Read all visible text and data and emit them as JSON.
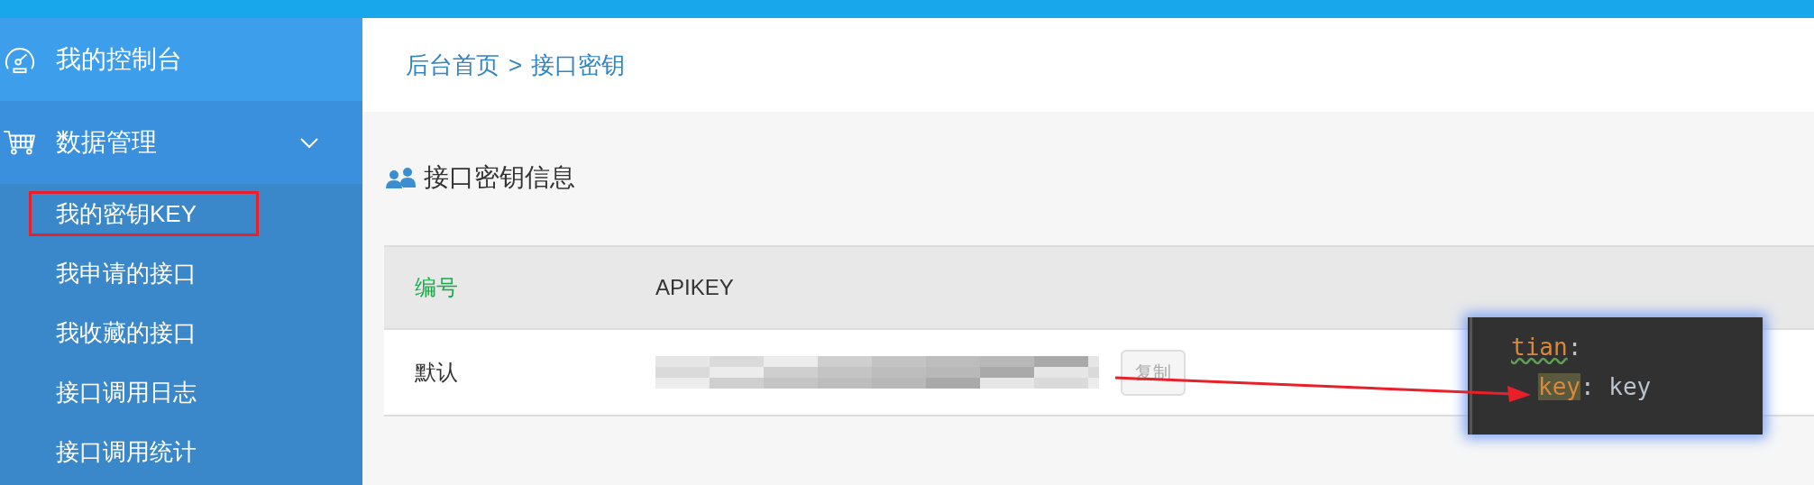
{
  "sidebar": {
    "items": [
      {
        "label": "我的控制台",
        "kind": "link"
      },
      {
        "label": "数据管理",
        "kind": "group",
        "expanded": true,
        "children": [
          {
            "label": "我的密钥KEY",
            "marked": true
          },
          {
            "label": "我申请的接口",
            "marked": false
          },
          {
            "label": "我收藏的接口",
            "marked": false
          },
          {
            "label": "接口调用日志",
            "marked": false
          },
          {
            "label": "接口调用统计",
            "marked": false
          }
        ]
      }
    ]
  },
  "breadcrumb": {
    "items": [
      "后台首页",
      "接口密钥"
    ],
    "separator": ">"
  },
  "section": {
    "title": "接口密钥信息"
  },
  "table": {
    "columns": [
      "编号",
      "APIKEY"
    ],
    "rows": [
      {
        "name": "默认",
        "action": "复制"
      }
    ]
  },
  "code_popup": {
    "lines": [
      {
        "tokens": [
          {
            "text": "tian",
            "kind": "key",
            "highlighted": false,
            "warning": true
          },
          {
            "text": ":",
            "kind": "punct",
            "highlighted": false,
            "warning": false
          }
        ]
      },
      {
        "tokens": [
          {
            "text": "key",
            "kind": "key",
            "highlighted": true,
            "warning": false
          },
          {
            "text": ": ",
            "kind": "punct",
            "highlighted": false,
            "warning": false
          },
          {
            "text": "key",
            "kind": "value",
            "highlighted": false,
            "warning": false
          }
        ]
      }
    ]
  }
}
